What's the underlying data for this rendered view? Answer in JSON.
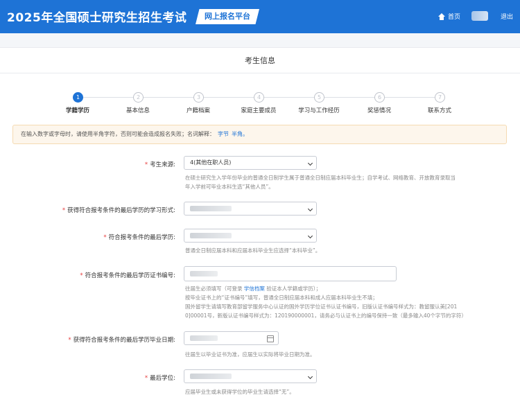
{
  "header": {
    "title": "2025年全国硕士研究生招生考试",
    "platform": "网上报名平台",
    "home_label": "首页",
    "logout_label": "退出"
  },
  "section_title": "考生信息",
  "steps": [
    {
      "num": "1",
      "label": "学籍学历"
    },
    {
      "num": "2",
      "label": "基本信息"
    },
    {
      "num": "3",
      "label": "户籍档案"
    },
    {
      "num": "4",
      "label": "家庭主要成员"
    },
    {
      "num": "5",
      "label": "学习与工作经历"
    },
    {
      "num": "6",
      "label": "奖惩情况"
    },
    {
      "num": "7",
      "label": "联系方式"
    }
  ],
  "notice": {
    "text": "在输入数字或字母时，请使用半角字符，否则可能会造成报名失败；名词解释：",
    "link1": "字节",
    "link2": "半角。"
  },
  "form": {
    "source": {
      "label": "考生来源:",
      "value": "4(其他在职人员)",
      "hint1": "在硕士研究生入学年份毕业的普通全日制学生属于普通全日制应届本科毕业生；自学考试、网络教育、开放教育录取当",
      "hint2": "年入学前可毕业本科生选“其他人员”。"
    },
    "study_form": {
      "label": "获得符合报考条件的最后学历的学习形式:"
    },
    "last_degree_edu": {
      "label": "符合报考条件的最后学历:",
      "hint": "普通全日制应届本科和应届本科毕业生应选择“本科毕业”。"
    },
    "certificate": {
      "label": "符合报考条件的最后学历证书编号:",
      "hint1_pre": "往届生必须填写（可登录 ",
      "hint1_link": "学信档案",
      "hint1_post": " 验证本人学籍或学历）；",
      "hint2": "按毕业证书上的“证书编号”填写，普通全日制应届本科和成人应届本科毕业生不填；",
      "hint3": "国外留学生请填写教育部留学服务中心认证的国外学历学位证书认证书编号，旧版认证书编号样式为：教留服认美[201",
      "hint4": "0]00001号，新版认证书编号样式为：120190000001，请务必与认证书上的编号保持一致（最多输入40个字节的字符）"
    },
    "grad_date": {
      "label": "获得符合报考条件的最后学历毕业日期:",
      "hint": "往届生以毕业证书为准，应届生以实际将毕业日期为准。"
    },
    "last_degree": {
      "label": "最后学位:",
      "hint": "应届毕业生或未获得学位的毕业生请选择“无”。"
    }
  },
  "colors": {
    "primary": "#1e73d6",
    "required": "#e63c3c",
    "notice_bg": "#fdf6ec"
  }
}
